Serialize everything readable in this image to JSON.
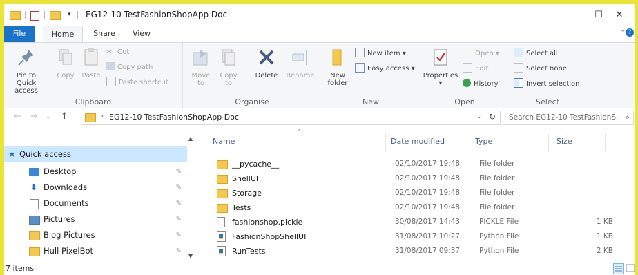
{
  "window": {
    "title": "EG12-10 TestFashionShopApp Doc",
    "minimize": "—",
    "maximize": "☐",
    "close": "✕"
  },
  "tabs": [
    {
      "label": "File"
    },
    {
      "label": "Home"
    },
    {
      "label": "Share"
    },
    {
      "label": "View"
    }
  ],
  "ribbon": {
    "clipboard": {
      "label": "Clipboard",
      "pin": "Pin to Quick access",
      "copy": "Copy",
      "paste": "Paste",
      "cut": "Cut",
      "copy_path": "Copy path",
      "paste_shortcut": "Paste shortcut"
    },
    "organise": {
      "label": "Organise",
      "move_to": "Move to",
      "copy_to": "Copy to",
      "delete": "Delete",
      "rename": "Rename"
    },
    "new": {
      "label": "New",
      "new_folder": "New folder",
      "new_item": "New item",
      "easy_access": "Easy access"
    },
    "open": {
      "label": "Open",
      "properties": "Properties",
      "open": "Open",
      "edit": "Edit",
      "history": "History"
    },
    "select": {
      "label": "Select",
      "select_all": "Select all",
      "select_none": "Select none",
      "invert": "Invert selection"
    }
  },
  "address": {
    "path": "EG12-10 TestFashionShopApp Doc",
    "search_placeholder": "Search EG12-10 TestFashionS..."
  },
  "nav": {
    "items": [
      {
        "label": "Quick access",
        "icon": "star-icon"
      },
      {
        "label": "Desktop",
        "icon": "desktop-icon"
      },
      {
        "label": "Downloads",
        "icon": "download-icon"
      },
      {
        "label": "Documents",
        "icon": "documents-icon"
      },
      {
        "label": "Pictures",
        "icon": "pictures-icon"
      },
      {
        "label": "Blog Pictures",
        "icon": "folder-icon"
      },
      {
        "label": "Hull PixelBot",
        "icon": "folder-icon"
      }
    ]
  },
  "columns": {
    "name": "Name",
    "date": "Date modified",
    "type": "Type",
    "size": "Size"
  },
  "files": [
    {
      "name": "__pycache__",
      "date": "02/10/2017 19:48",
      "type": "File folder",
      "size": "",
      "kind": "folder"
    },
    {
      "name": "ShellUI",
      "date": "02/10/2017 19:48",
      "type": "File folder",
      "size": "",
      "kind": "folder"
    },
    {
      "name": "Storage",
      "date": "02/10/2017 19:48",
      "type": "File folder",
      "size": "",
      "kind": "folder"
    },
    {
      "name": "Tests",
      "date": "02/10/2017 19:48",
      "type": "File folder",
      "size": "",
      "kind": "folder"
    },
    {
      "name": "fashionshop.pickle",
      "date": "30/08/2017 14:43",
      "type": "PICKLE File",
      "size": "1 KB",
      "kind": "doc"
    },
    {
      "name": "FashionShopShellUI",
      "date": "31/08/2017 10:27",
      "type": "Python File",
      "size": "1 KB",
      "kind": "py"
    },
    {
      "name": "RunTests",
      "date": "31/08/2017 09:37",
      "type": "Python File",
      "size": "2 KB",
      "kind": "py"
    }
  ],
  "status": {
    "item_count": "7 items"
  },
  "colors": {
    "accent": "#1a73c8",
    "selection": "#cce8ff",
    "folder": "#f2c94c",
    "background": "#e9e537"
  }
}
